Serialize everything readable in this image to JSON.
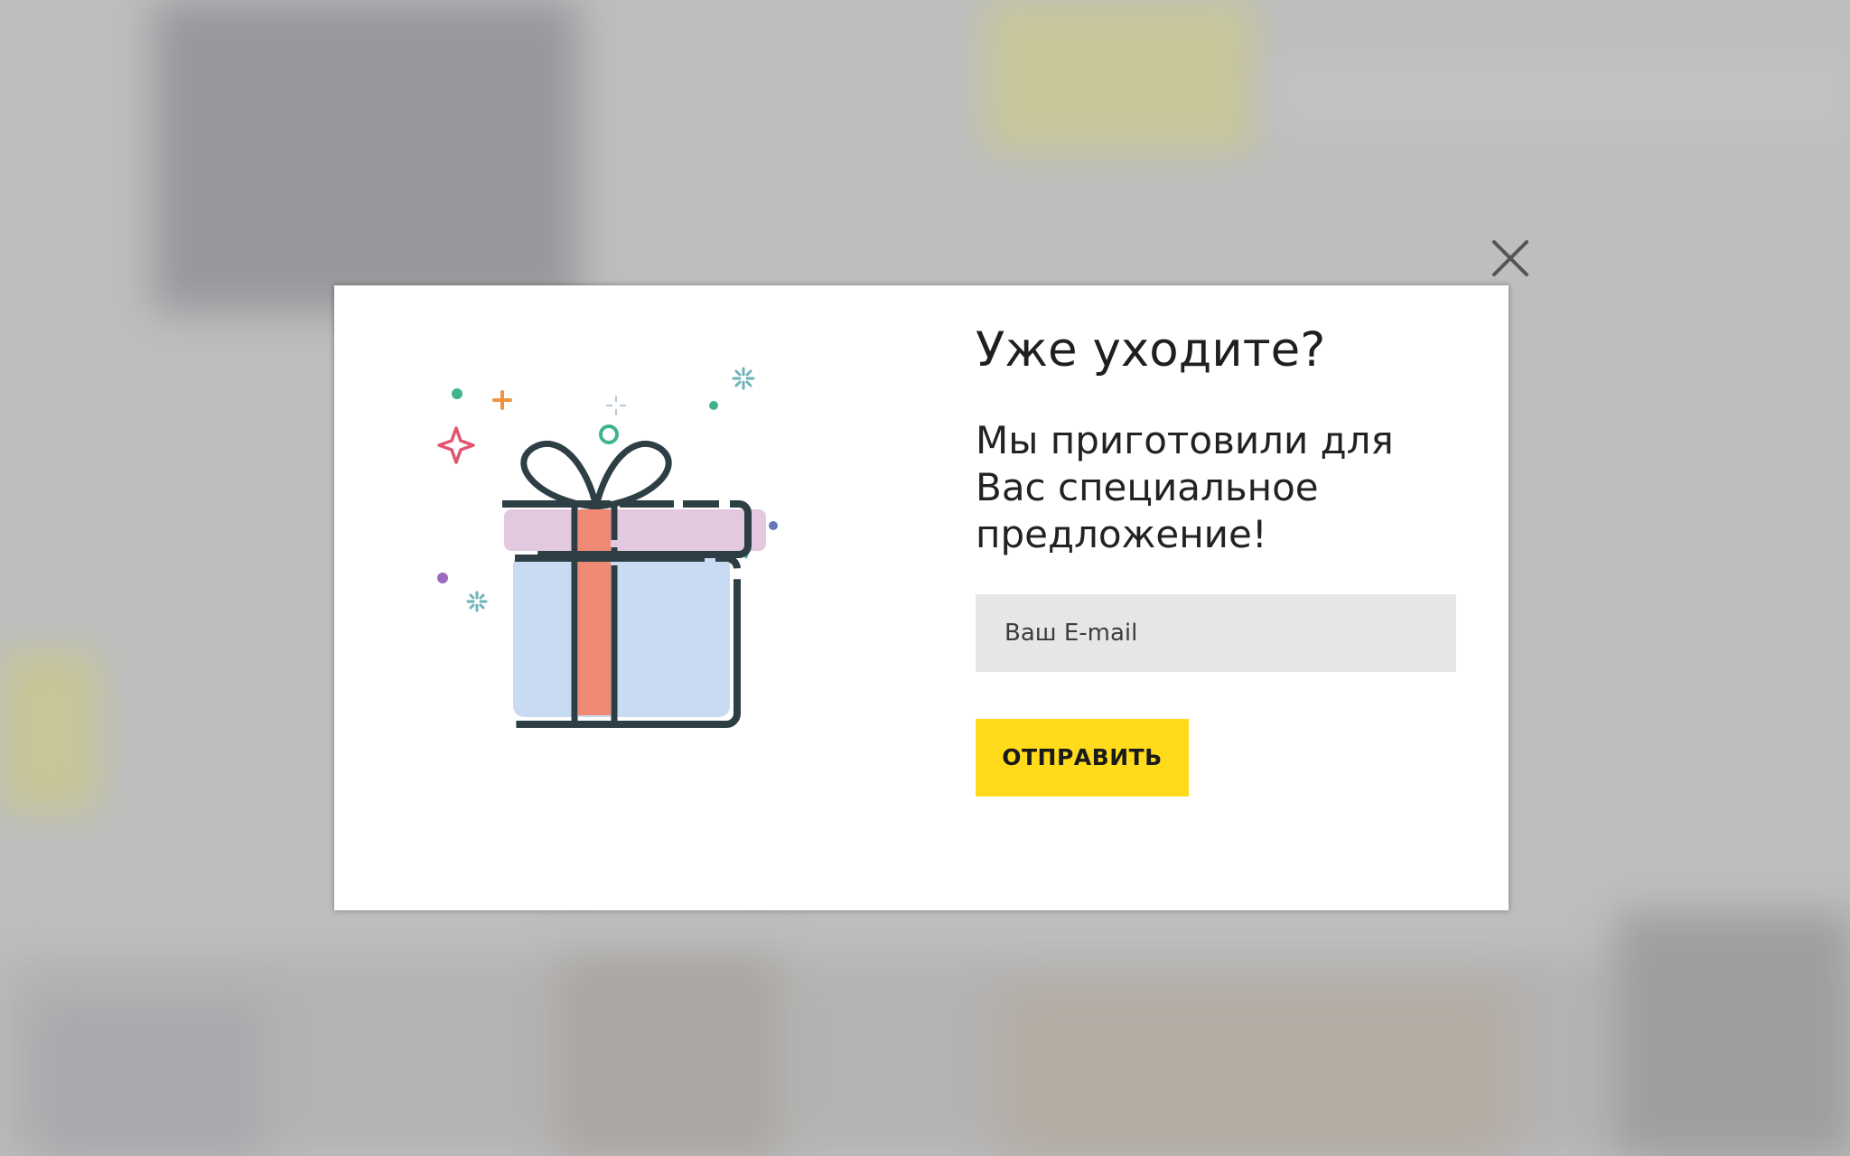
{
  "popup": {
    "title": "Уже уходите?",
    "subtitle": "Мы приготовили для Вас специальное предложение!",
    "email_placeholder": "Ваш E-mail",
    "submit_label": "ОТПРАВИТЬ",
    "close_icon": "close-icon",
    "illustration_icon": "gift-box-icon"
  },
  "colors": {
    "button": "#ffdb1c",
    "input_bg": "#e6e6e6",
    "ribbon": "#f08a74",
    "box_body": "#c9dbf2",
    "box_lid": "#e3c9e0",
    "outline": "#2d3e44"
  }
}
